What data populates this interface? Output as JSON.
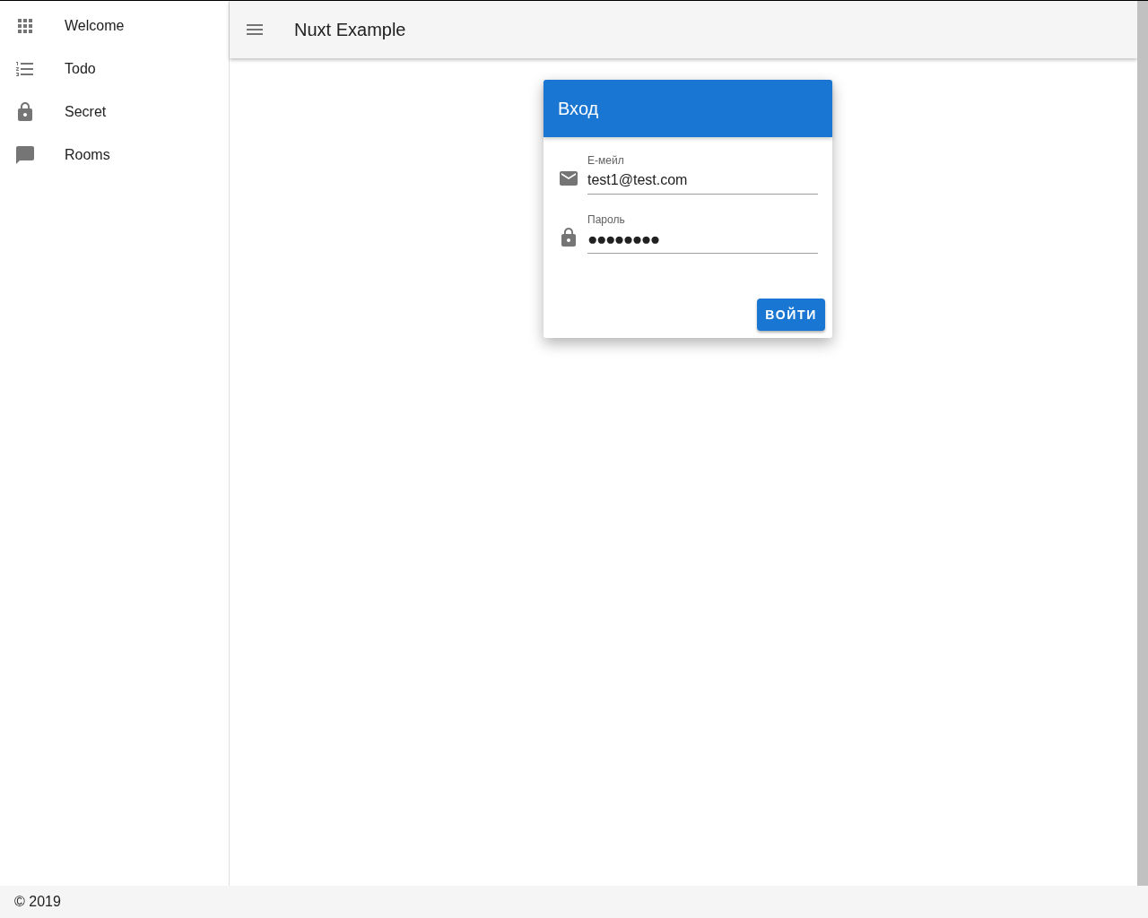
{
  "sidebar": {
    "items": [
      {
        "label": "Welcome"
      },
      {
        "label": "Todo"
      },
      {
        "label": "Secret"
      },
      {
        "label": "Rooms"
      }
    ]
  },
  "toolbar": {
    "title": "Nuxt Example"
  },
  "login_card": {
    "title": "Вход",
    "fields": [
      {
        "label": "Е-мейл",
        "value": "test1@test.com"
      },
      {
        "label": "Пароль",
        "value": "●●●●●●●●"
      }
    ],
    "button": "ВОЙТИ"
  },
  "footer": {
    "text": "© 2019"
  }
}
